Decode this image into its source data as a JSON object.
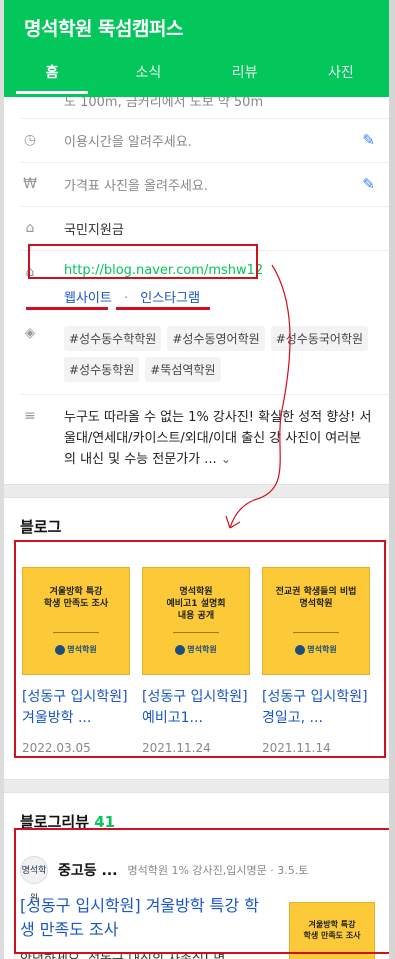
{
  "header": {
    "title": "명석학원 뚝섬캠퍼스"
  },
  "tabs": [
    {
      "label": "홈"
    },
    {
      "label": "소식"
    },
    {
      "label": "리뷰"
    },
    {
      "label": "사진"
    }
  ],
  "info": {
    "partial_row": "도 100m, 금커리에서 도보 약 50m",
    "hours_prompt": "이용시간을 알려주세요.",
    "price_prompt": "가격표 사진을 올려주세요.",
    "payment": "국민지원금",
    "url": "http://blog.naver.com/mshw12",
    "website": "웹사이트",
    "separator": "·",
    "instagram": "인스타그램",
    "tags": [
      "#성수동수학학원",
      "#성수동영어학원",
      "#성수동국어학원",
      "#성수동학원",
      "#뚝섬역학원"
    ],
    "description": "누구도 따라올 수 없는 1% 강사진! 확실한 성적 향상! 서울대/연세대/카이스트/외대/이대 출신 강 사진이 여러분의 내신 및 수능 전문가가 ...",
    "more_icon": "chevron-down-icon"
  },
  "blog": {
    "title": "블로그",
    "cards": [
      {
        "thumb_text": "겨울방학 특강\n학생 만족도 조사",
        "logo": "명석학원",
        "title": "[성동구 입시학원] 겨울방학 ...",
        "date": "2022.03.05"
      },
      {
        "thumb_text": "명석학원\n예비고1 설명회\n내용 공개",
        "logo": "명석학원",
        "title": "[성동구 입시학원] 예비고1...",
        "date": "2021.11.24"
      },
      {
        "thumb_text": "전교권 학생들의 비법\n명석학원",
        "logo": "명석학원",
        "title": "[성동구 입시학원] 경일고, ...",
        "date": "2021.11.14"
      }
    ]
  },
  "blog_review": {
    "title": "블로그리뷰",
    "count": "41",
    "item": {
      "author": "중고등 ...",
      "meta": "명석학원 1% 강사진,입시명문 · 3.5.토",
      "title": "[성동구 입시학원] 겨울방학 특강 학생 만족도 조사",
      "snippet": "안녕하세요, 성동구 내신의 자존심! 명",
      "thumb_text": "겨울방학 특강\n학생 만족도 조사",
      "avatar_text": "명석학원"
    }
  },
  "colors": {
    "brand": "#03c75a",
    "link_blue": "#1a56c8",
    "annotation_red": "#d0101e",
    "thumb_yellow": "#fcca38"
  }
}
